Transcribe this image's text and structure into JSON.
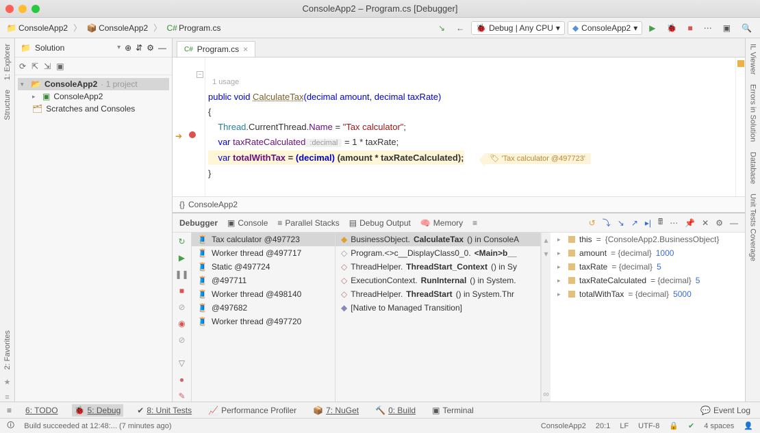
{
  "window": {
    "title": "ConsoleApp2 – Program.cs [Debugger]"
  },
  "breadcrumbs": {
    "items": [
      "ConsoleApp2",
      "ConsoleApp2",
      "Program.cs"
    ]
  },
  "toolbar": {
    "config_label": "Debug | Any CPU",
    "run_target": "ConsoleApp2"
  },
  "solution_panel": {
    "title": "Solution",
    "root": "ConsoleApp2",
    "root_suffix": " · 1 project",
    "project": "ConsoleApp2",
    "scratches": "Scratches and Consoles"
  },
  "editor": {
    "tab_label": "Program.cs",
    "usage_hint": "1 usage",
    "code": {
      "sig_prefix": "public void ",
      "method": "CalculateTax",
      "sig_params": "(decimal amount, decimal taxRate)",
      "open_brace": "{",
      "l1_a": "Thread",
      "l1_b": ".CurrentThread.",
      "l1_c": "Name",
      "l1_d": " = ",
      "l1_e": "\"Tax calculator\"",
      "l1_f": ";",
      "l2_a": "var ",
      "l2_b": "taxRateCalculated",
      "l2_c": " :decimal ",
      "l2_d": " = 1 * taxRate;",
      "l3_a": "var ",
      "l3_b": "totalWithTax",
      "l3_c": " = ",
      "l3_d": "(decimal)",
      "l3_e": " (amount * taxRateCalculated);",
      "close_brace1": "}",
      "close_brace2": "}",
      "close_brace3": "}",
      "inline_hint_icon": "🏷",
      "inline_hint": "'Tax calculator @497723'"
    },
    "nav_crumb": "ConsoleApp2"
  },
  "side_tabs_left": [
    "1: Explorer",
    "Structure"
  ],
  "side_tabs_left_bottom": [
    "2: Favorites"
  ],
  "side_tabs_right": [
    "IL Viewer",
    "Errors in Solution",
    "Database",
    "Unit Tests Coverage"
  ],
  "debug": {
    "tabs": [
      "Debugger",
      "Console",
      "Parallel Stacks",
      "Debug Output",
      "Memory"
    ],
    "threads": [
      "Tax calculator @497723",
      "Worker thread @497717",
      "Static @497724",
      " @497711",
      "Worker thread @498140",
      " @497682",
      "Worker thread @497720"
    ],
    "frames": [
      {
        "cls": "BusinessObject.",
        "m": "CalculateTax",
        "suffix": "() in ConsoleA"
      },
      {
        "cls": "Program.<>c__DisplayClass0_0.",
        "m": "<Main>b__",
        "suffix": ""
      },
      {
        "cls": "ThreadHelper.",
        "m": "ThreadStart_Context",
        "suffix": "() in Sy"
      },
      {
        "cls": "ExecutionContext.",
        "m": "RunInternal",
        "suffix": "() in System."
      },
      {
        "cls": "ThreadHelper.",
        "m": "ThreadStart",
        "suffix": "() in System.Thr"
      },
      {
        "cls": "",
        "m": "[Native to Managed Transition]",
        "suffix": ""
      }
    ],
    "vars": [
      {
        "name": "this",
        "eq": " = ",
        "val": "{ConsoleApp2.BusinessObject}"
      },
      {
        "name": "amount",
        "eq": " = {decimal} ",
        "val": "1000"
      },
      {
        "name": "taxRate",
        "eq": " = {decimal} ",
        "val": "5"
      },
      {
        "name": "taxRateCalculated",
        "eq": " = {decimal} ",
        "val": "5"
      },
      {
        "name": "totalWithTax",
        "eq": " = {decimal} ",
        "val": "5000"
      }
    ]
  },
  "bottom_tools": {
    "todo": "6: TODO",
    "debug": "5: Debug",
    "unit_tests": "8: Unit Tests",
    "perf": "Performance Profiler",
    "nuget": "7: NuGet",
    "build": "0: Build",
    "terminal": "Terminal",
    "event_log": "Event Log"
  },
  "status": {
    "msg": "Build succeeded at 12:48:... (7 minutes ago)",
    "app": "ConsoleApp2",
    "pos": "20:1",
    "eol": "LF",
    "enc": "UTF-8",
    "spaces": "4 spaces"
  }
}
